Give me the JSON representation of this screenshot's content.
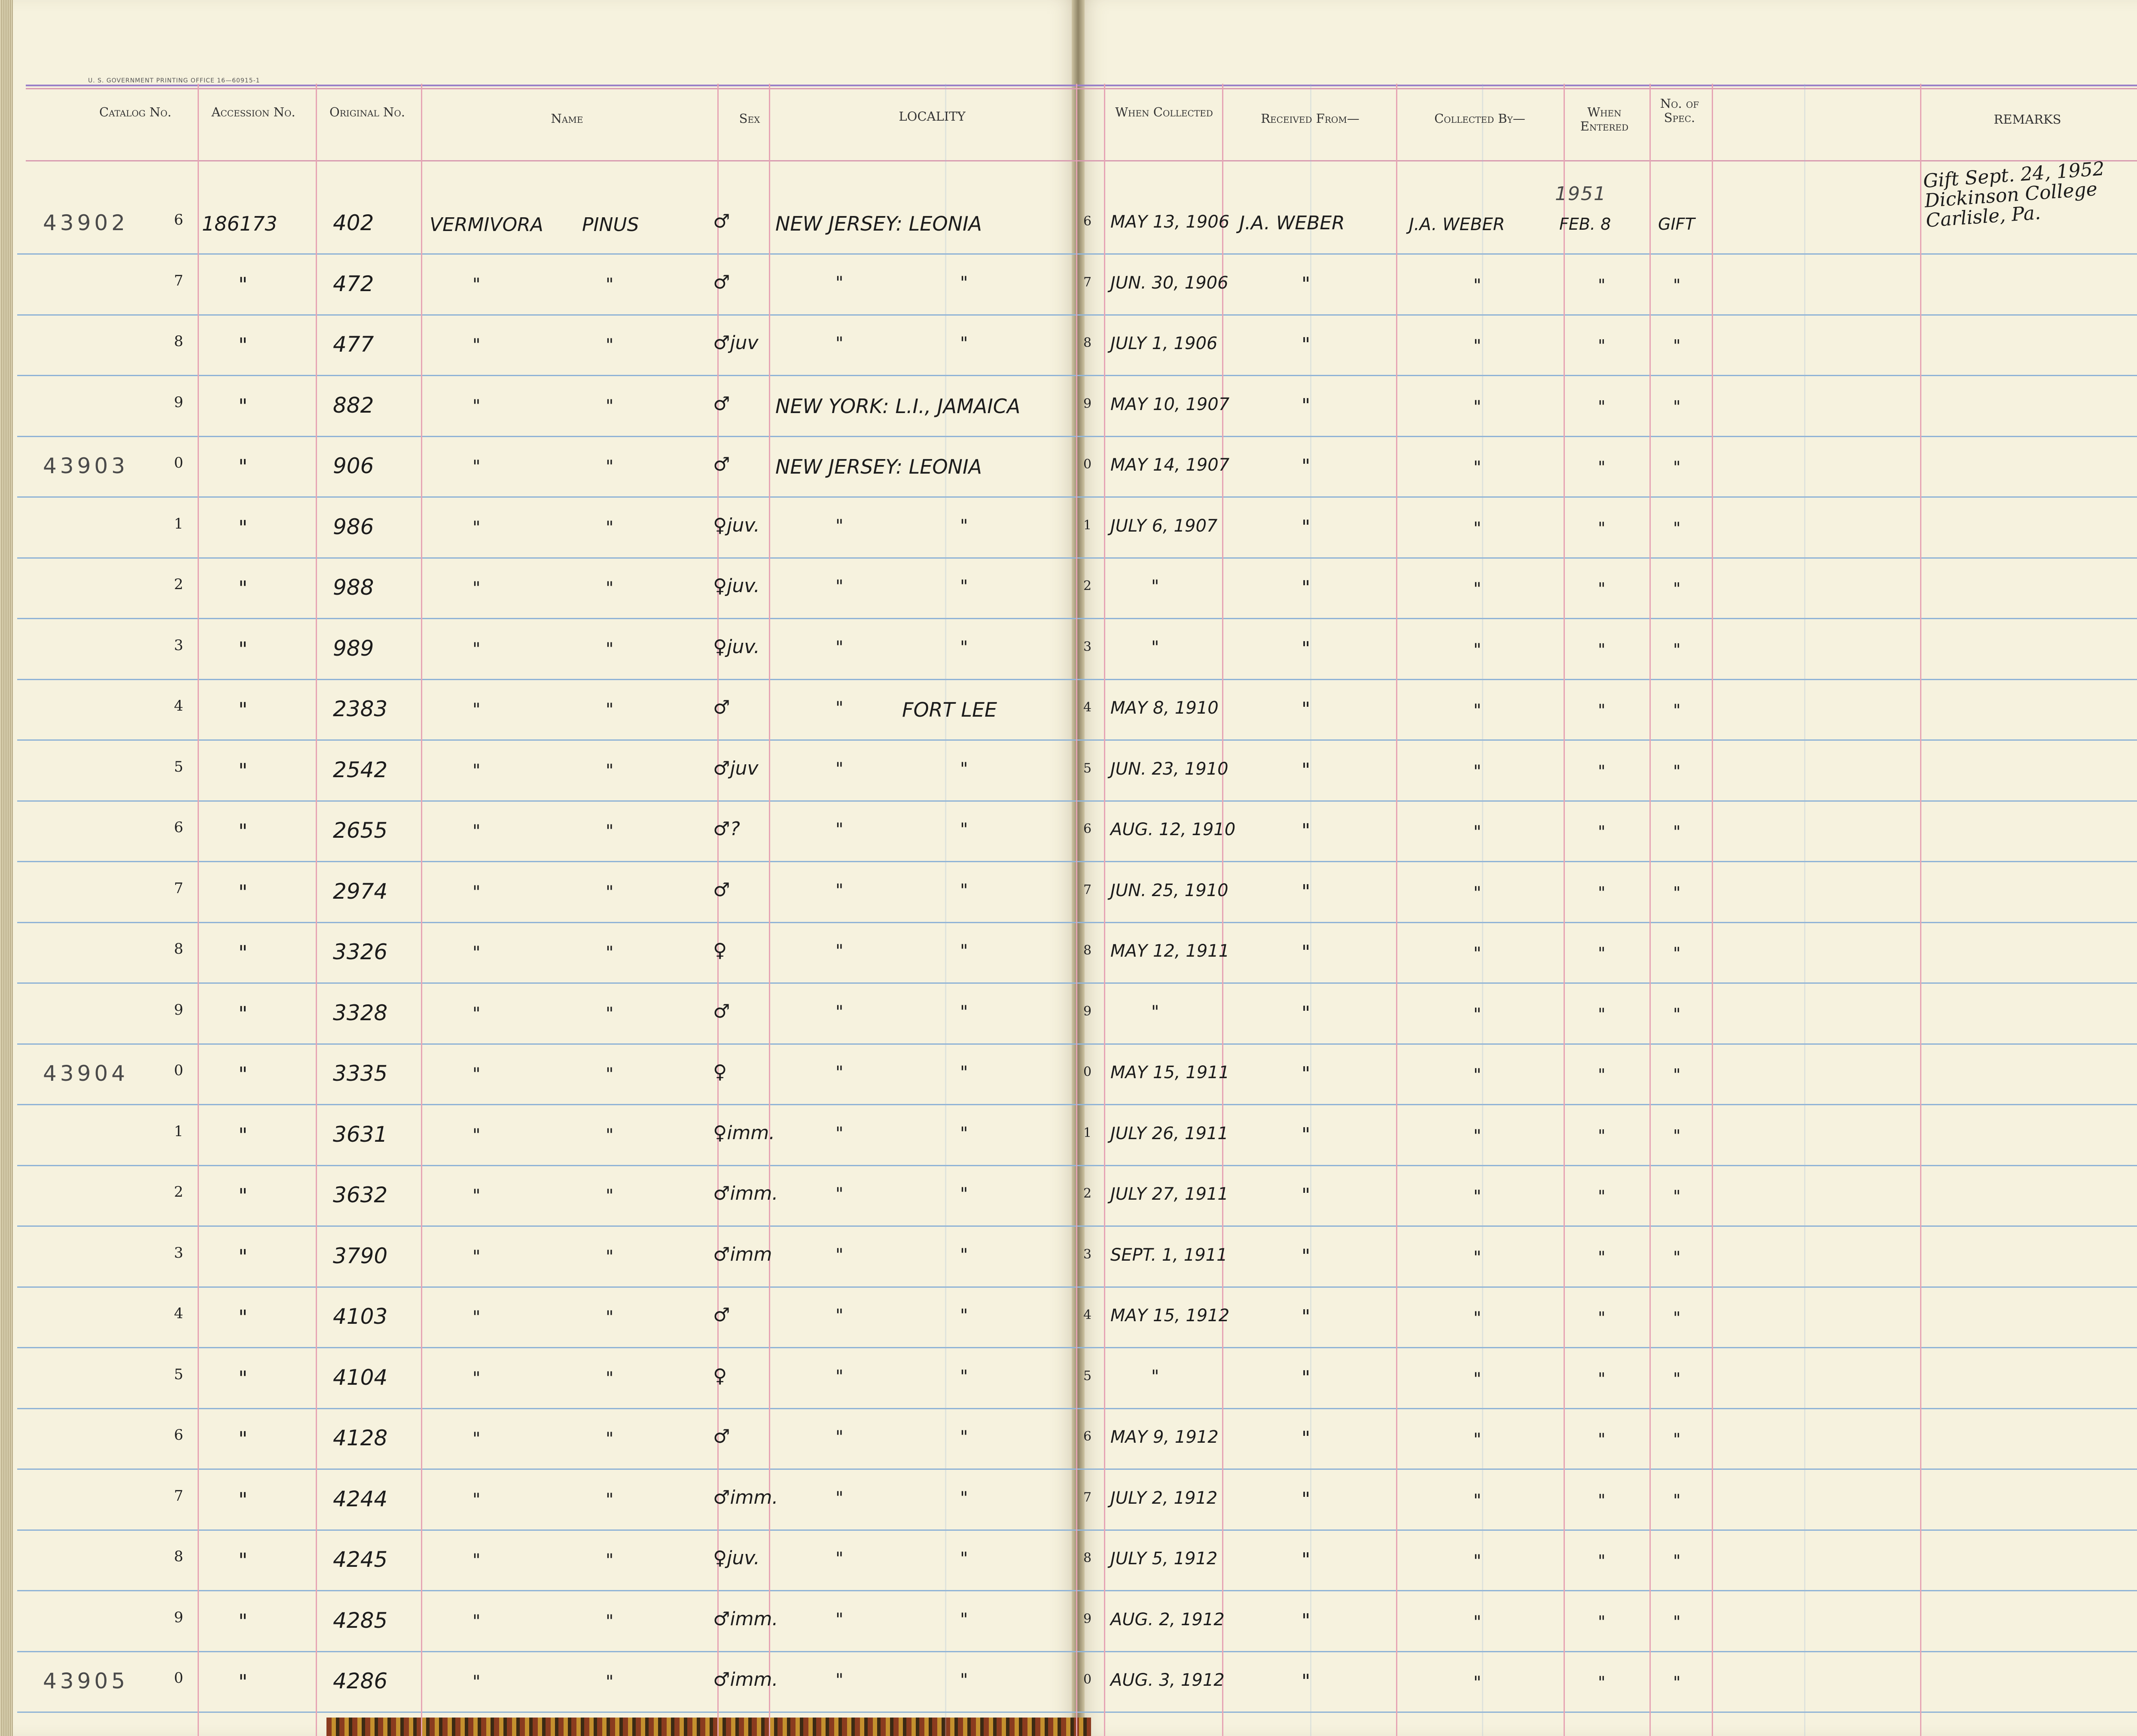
{
  "header": {
    "gpo_line": "U. S. GOVERNMENT PRINTING OFFICE   16—60915-1",
    "catalog_no": "Catalog No.",
    "accession_no": "Accession No.",
    "original_no": "Original No.",
    "name": "Name",
    "sex": "Sex",
    "locality": "LOCALITY",
    "when_collected": "When Collected",
    "received_from": "Received From—",
    "collected_by": "Collected By—",
    "when_entered": "When Entered",
    "no_of_spec": "No. of Spec.",
    "remarks": "REMARKS"
  },
  "catalog_bases": [
    {
      "row": 0,
      "text": "43902"
    },
    {
      "row": 4,
      "text": "43903"
    },
    {
      "row": 14,
      "text": "43904"
    },
    {
      "row": 24,
      "text": "43905"
    }
  ],
  "rows": [
    {
      "digit": "6",
      "accession": "186173",
      "original": "402",
      "name1": "Vermivora",
      "name2": "pinus",
      "sex": "♂",
      "loc1": "New Jersey: Leonia",
      "loc2": "",
      "loc_digit": "6",
      "collected": "May 13, 1906",
      "received": "J.A. Weber",
      "collector": "J.A. Weber",
      "entered": "Feb. 8",
      "spec": "Gift"
    },
    {
      "digit": "7",
      "accession": "\"",
      "original": "472",
      "name1": "\"",
      "name2": "\"",
      "sex": "♂",
      "loc1": "\"",
      "loc2": "\"",
      "loc_digit": "7",
      "collected": "Jun. 30, 1906",
      "received": "\"",
      "collector": "\"",
      "entered": "\"",
      "spec": "\""
    },
    {
      "digit": "8",
      "accession": "\"",
      "original": "477",
      "name1": "\"",
      "name2": "\"",
      "sex": "♂juv",
      "loc1": "\"",
      "loc2": "\"",
      "loc_digit": "8",
      "collected": "July 1, 1906",
      "received": "\"",
      "collector": "\"",
      "entered": "\"",
      "spec": "\""
    },
    {
      "digit": "9",
      "accession": "\"",
      "original": "882",
      "name1": "\"",
      "name2": "\"",
      "sex": "♂",
      "loc1": "New York: L.I., Jamaica",
      "loc2": "",
      "loc_digit": "9",
      "collected": "May 10, 1907",
      "received": "\"",
      "collector": "\"",
      "entered": "\"",
      "spec": "\""
    },
    {
      "digit": "0",
      "accession": "\"",
      "original": "906",
      "name1": "\"",
      "name2": "\"",
      "sex": "♂",
      "loc1": "New Jersey: Leonia",
      "loc2": "",
      "loc_digit": "0",
      "collected": "May 14, 1907",
      "received": "\"",
      "collector": "\"",
      "entered": "\"",
      "spec": "\""
    },
    {
      "digit": "1",
      "accession": "\"",
      "original": "986",
      "name1": "\"",
      "name2": "\"",
      "sex": "♀juv.",
      "loc1": "\"",
      "loc2": "\"",
      "loc_digit": "1",
      "collected": "July 6, 1907",
      "received": "\"",
      "collector": "\"",
      "entered": "\"",
      "spec": "\""
    },
    {
      "digit": "2",
      "accession": "\"",
      "original": "988",
      "name1": "\"",
      "name2": "\"",
      "sex": "♀juv.",
      "loc1": "\"",
      "loc2": "\"",
      "loc_digit": "2",
      "collected": "\"",
      "received": "\"",
      "collector": "\"",
      "entered": "\"",
      "spec": "\""
    },
    {
      "digit": "3",
      "accession": "\"",
      "original": "989",
      "name1": "\"",
      "name2": "\"",
      "sex": "♀juv.",
      "loc1": "\"",
      "loc2": "\"",
      "loc_digit": "3",
      "collected": "\"",
      "received": "\"",
      "collector": "\"",
      "entered": "\"",
      "spec": "\""
    },
    {
      "digit": "4",
      "accession": "\"",
      "original": "2383",
      "name1": "\"",
      "name2": "\"",
      "sex": "♂",
      "loc1": "\"",
      "loc2": "Fort Lee",
      "loc_digit": "4",
      "collected": "May 8, 1910",
      "received": "\"",
      "collector": "\"",
      "entered": "\"",
      "spec": "\""
    },
    {
      "digit": "5",
      "accession": "\"",
      "original": "2542",
      "name1": "\"",
      "name2": "\"",
      "sex": "♂juv",
      "loc1": "\"",
      "loc2": "\"",
      "loc_digit": "5",
      "collected": "Jun. 23, 1910",
      "received": "\"",
      "collector": "\"",
      "entered": "\"",
      "spec": "\""
    },
    {
      "digit": "6",
      "accession": "\"",
      "original": "2655",
      "name1": "\"",
      "name2": "\"",
      "sex": "♂?",
      "loc1": "\"",
      "loc2": "\"",
      "loc_digit": "6",
      "collected": "Aug. 12, 1910",
      "received": "\"",
      "collector": "\"",
      "entered": "\"",
      "spec": "\""
    },
    {
      "digit": "7",
      "accession": "\"",
      "original": "2974",
      "name1": "\"",
      "name2": "\"",
      "sex": "♂",
      "loc1": "\"",
      "loc2": "\"",
      "loc_digit": "7",
      "collected": "Jun. 25, 1910",
      "received": "\"",
      "collector": "\"",
      "entered": "\"",
      "spec": "\""
    },
    {
      "digit": "8",
      "accession": "\"",
      "original": "3326",
      "name1": "\"",
      "name2": "\"",
      "sex": "♀",
      "loc1": "\"",
      "loc2": "\"",
      "loc_digit": "8",
      "collected": "May 12, 1911",
      "received": "\"",
      "collector": "\"",
      "entered": "\"",
      "spec": "\""
    },
    {
      "digit": "9",
      "accession": "\"",
      "original": "3328",
      "name1": "\"",
      "name2": "\"",
      "sex": "♂",
      "loc1": "\"",
      "loc2": "\"",
      "loc_digit": "9",
      "collected": "\"",
      "received": "\"",
      "collector": "\"",
      "entered": "\"",
      "spec": "\""
    },
    {
      "digit": "0",
      "accession": "\"",
      "original": "3335",
      "name1": "\"",
      "name2": "\"",
      "sex": "♀",
      "loc1": "\"",
      "loc2": "\"",
      "loc_digit": "0",
      "collected": "May 15, 1911",
      "received": "\"",
      "collector": "\"",
      "entered": "\"",
      "spec": "\""
    },
    {
      "digit": "1",
      "accession": "\"",
      "original": "3631",
      "name1": "\"",
      "name2": "\"",
      "sex": "♀imm.",
      "loc1": "\"",
      "loc2": "\"",
      "loc_digit": "1",
      "collected": "July 26, 1911",
      "received": "\"",
      "collector": "\"",
      "entered": "\"",
      "spec": "\""
    },
    {
      "digit": "2",
      "accession": "\"",
      "original": "3632",
      "name1": "\"",
      "name2": "\"",
      "sex": "♂imm.",
      "loc1": "\"",
      "loc2": "\"",
      "loc_digit": "2",
      "collected": "July 27, 1911",
      "received": "\"",
      "collector": "\"",
      "entered": "\"",
      "spec": "\""
    },
    {
      "digit": "3",
      "accession": "\"",
      "original": "3790",
      "name1": "\"",
      "name2": "\"",
      "sex": "♂imm",
      "loc1": "\"",
      "loc2": "\"",
      "loc_digit": "3",
      "collected": "Sept. 1, 1911",
      "received": "\"",
      "collector": "\"",
      "entered": "\"",
      "spec": "\""
    },
    {
      "digit": "4",
      "accession": "\"",
      "original": "4103",
      "name1": "\"",
      "name2": "\"",
      "sex": "♂",
      "loc1": "\"",
      "loc2": "\"",
      "loc_digit": "4",
      "collected": "May 15, 1912",
      "received": "\"",
      "collector": "\"",
      "entered": "\"",
      "spec": "\""
    },
    {
      "digit": "5",
      "accession": "\"",
      "original": "4104",
      "name1": "\"",
      "name2": "\"",
      "sex": "♀",
      "loc1": "\"",
      "loc2": "\"",
      "loc_digit": "5",
      "collected": "\"",
      "received": "\"",
      "collector": "\"",
      "entered": "\"",
      "spec": "\""
    },
    {
      "digit": "6",
      "accession": "\"",
      "original": "4128",
      "name1": "\"",
      "name2": "\"",
      "sex": "♂",
      "loc1": "\"",
      "loc2": "\"",
      "loc_digit": "6",
      "collected": "May 9, 1912",
      "received": "\"",
      "collector": "\"",
      "entered": "\"",
      "spec": "\""
    },
    {
      "digit": "7",
      "accession": "\"",
      "original": "4244",
      "name1": "\"",
      "name2": "\"",
      "sex": "♂imm.",
      "loc1": "\"",
      "loc2": "\"",
      "loc_digit": "7",
      "collected": "July 2, 1912",
      "received": "\"",
      "collector": "\"",
      "entered": "\"",
      "spec": "\""
    },
    {
      "digit": "8",
      "accession": "\"",
      "original": "4245",
      "name1": "\"",
      "name2": "\"",
      "sex": "♀juv.",
      "loc1": "\"",
      "loc2": "\"",
      "loc_digit": "8",
      "collected": "July 5, 1912",
      "received": "\"",
      "collector": "\"",
      "entered": "\"",
      "spec": "\""
    },
    {
      "digit": "9",
      "accession": "\"",
      "original": "4285",
      "name1": "\"",
      "name2": "\"",
      "sex": "♂imm.",
      "loc1": "\"",
      "loc2": "\"",
      "loc_digit": "9",
      "collected": "Aug. 2, 1912",
      "received": "\"",
      "collector": "\"",
      "entered": "\"",
      "spec": "\""
    },
    {
      "digit": "0",
      "accession": "\"",
      "original": "4286",
      "name1": "\"",
      "name2": "\"",
      "sex": "♂imm.",
      "loc1": "\"",
      "loc2": "\"",
      "loc_digit": "0",
      "collected": "Aug. 3, 1912",
      "received": "\"",
      "collector": "\"",
      "entered": "\"",
      "spec": "\""
    }
  ],
  "entered_year": "1951",
  "remarks_note": [
    "Gift Sept. 24, 1952",
    "Dickinson College",
    "Carlisle, Pa."
  ]
}
